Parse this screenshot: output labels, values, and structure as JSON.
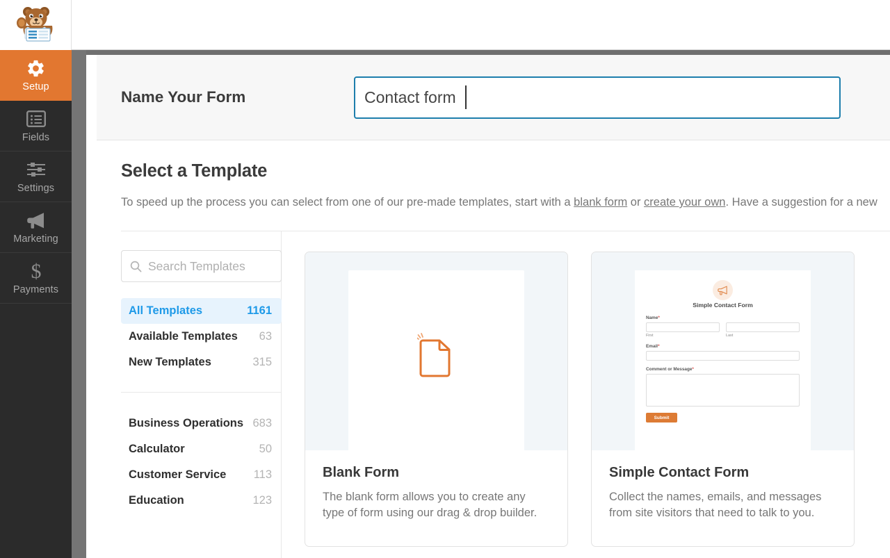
{
  "sidebar": {
    "mascot_icon": "wpforms-bear-mascot-icon",
    "items": [
      {
        "label": "Setup",
        "icon": "gear-icon",
        "active": true
      },
      {
        "label": "Fields",
        "icon": "list-icon",
        "active": false
      },
      {
        "label": "Settings",
        "icon": "sliders-icon",
        "active": false
      },
      {
        "label": "Marketing",
        "icon": "megaphone-icon",
        "active": false
      },
      {
        "label": "Payments",
        "icon": "dollar-icon",
        "active": false
      }
    ]
  },
  "form_name": {
    "label": "Name Your Form",
    "value": "Contact form",
    "placeholder": "Name Your Form"
  },
  "templates": {
    "heading": "Select a Template",
    "description_part1": "To speed up the process you can select from one of our pre-made templates, start with a ",
    "link_blank": "blank form",
    "description_part2": " or ",
    "link_create": "create your own",
    "description_part3": ". Have a suggestion for a new",
    "search_placeholder": "Search Templates",
    "search_value": "",
    "search_icon": "search-icon",
    "filters": [
      {
        "label": "All Templates",
        "count": "1161",
        "active": true
      },
      {
        "label": "Available Templates",
        "count": "63",
        "active": false
      },
      {
        "label": "New Templates",
        "count": "315",
        "active": false
      }
    ],
    "categories": [
      {
        "label": "Business Operations",
        "count": "683"
      },
      {
        "label": "Calculator",
        "count": "50"
      },
      {
        "label": "Customer Service",
        "count": "113"
      },
      {
        "label": "Education",
        "count": "123"
      }
    ],
    "cards": [
      {
        "title": "Blank Form",
        "description": "The blank form allows you to create any type of form using our drag & drop builder.",
        "preview_icon": "blank-document-icon"
      },
      {
        "title": "Simple Contact Form",
        "description": "Collect the names, emails, and messages from site visitors that need to talk to you.",
        "preview_icon": "megaphone-icon",
        "preview": {
          "title": "Simple Contact Form",
          "name_label": "Name",
          "name_required": "*",
          "first_sub": "First",
          "last_sub": "Last",
          "email_label": "Email",
          "email_required": "*",
          "message_label": "Comment or Message",
          "message_required": "*",
          "submit_label": "Submit"
        }
      }
    ]
  },
  "colors": {
    "accent_orange": "#e27730",
    "sidebar_dark": "#2b2b2b",
    "link_blue": "#1f9ae8",
    "input_focus_blue": "#1d7eac",
    "submit_orange": "#dd7b34"
  }
}
